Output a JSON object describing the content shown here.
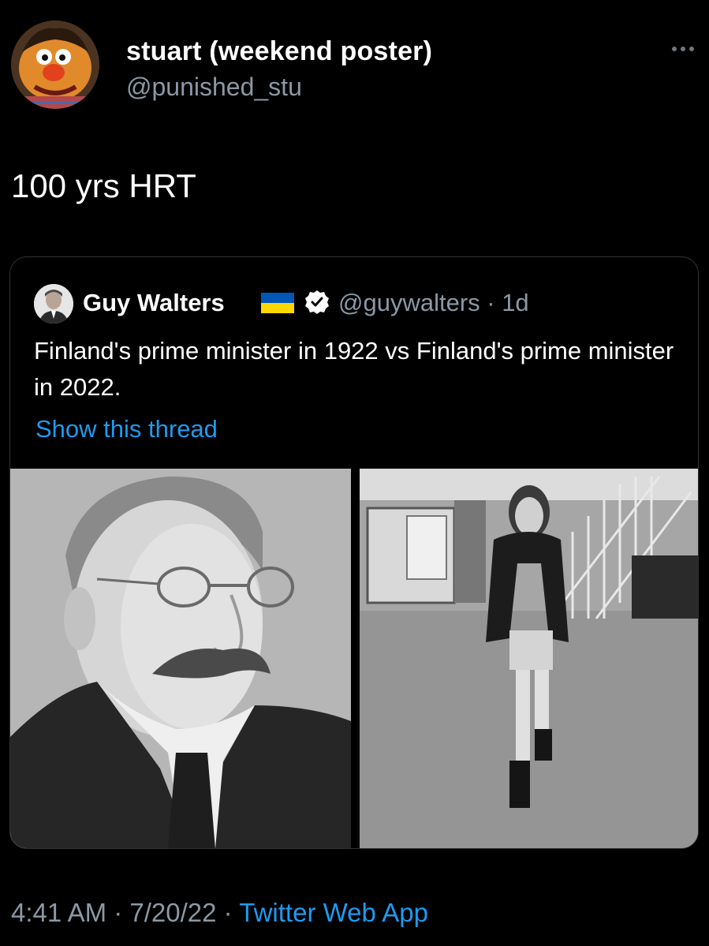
{
  "author": {
    "display_name": "stuart (weekend poster)",
    "handle": "@punished_stu"
  },
  "tweet": {
    "text": "100 yrs HRT"
  },
  "quoted_tweet": {
    "name": "Guy Walters",
    "handle_time": "@guywalters · 1d",
    "text": "Finland's prime minister in 1922 vs Finland's prime minister in 2022.",
    "show_thread": "Show this thread",
    "flag_colors": [
      "#0057B7",
      "#FFD700"
    ]
  },
  "footer": {
    "time": "4:41 AM",
    "sep1": " · ",
    "date": "7/20/22",
    "sep2": " · ",
    "source": "Twitter Web App"
  },
  "colors": {
    "background": "#000000",
    "secondary_text": "#8b98a5",
    "link": "#1d9bf0",
    "border": "#2f3336"
  },
  "icons": [
    "more-icon",
    "verified-icon",
    "ukraine-flag-icon"
  ]
}
